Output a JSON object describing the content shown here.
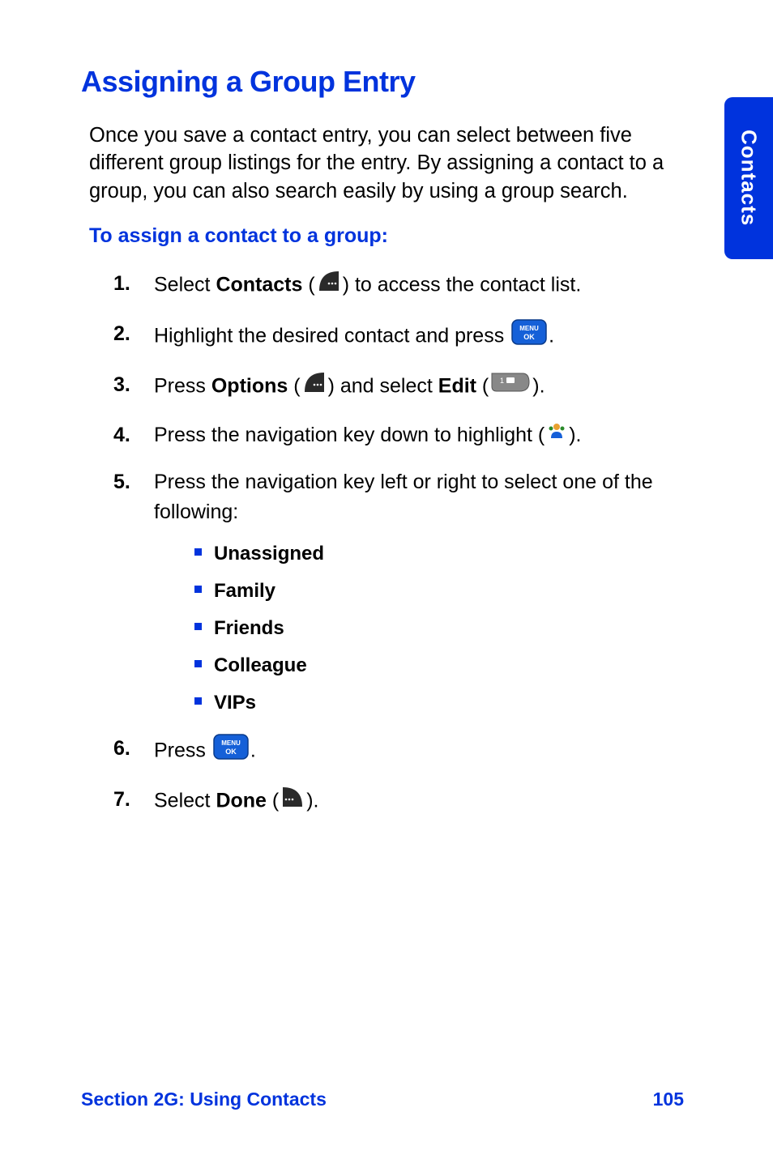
{
  "sideTab": "Contacts",
  "title": "Assigning a Group Entry",
  "intro": "Once you save a contact entry, you can select between five different group listings for the entry. By assigning a contact to a group, you can also search easily by using a group search.",
  "subheading": "To assign a contact to a group:",
  "steps": {
    "s1": {
      "num": "1.",
      "pre": "Select ",
      "bold": "Contacts",
      "post": " to access the contact list."
    },
    "s2": {
      "num": "2.",
      "pre": "Highlight the desired contact and press "
    },
    "s3": {
      "num": "3.",
      "pre": "Press ",
      "bold1": "Options",
      "mid": " and select ",
      "bold2": "Edit"
    },
    "s4": {
      "num": "4.",
      "pre": "Press the navigation key down to highlight (",
      "post": ")."
    },
    "s5": {
      "num": "5.",
      "text": "Press the navigation key left or right to select one of the following:"
    },
    "s6": {
      "num": "6.",
      "pre": "Press "
    },
    "s7": {
      "num": "7.",
      "pre": "Select ",
      "bold": "Done"
    }
  },
  "groups": [
    "Unassigned",
    "Family",
    "Friends",
    "Colleague",
    "VIPs"
  ],
  "footer": {
    "section": "Section 2G: Using Contacts",
    "page": "105"
  }
}
